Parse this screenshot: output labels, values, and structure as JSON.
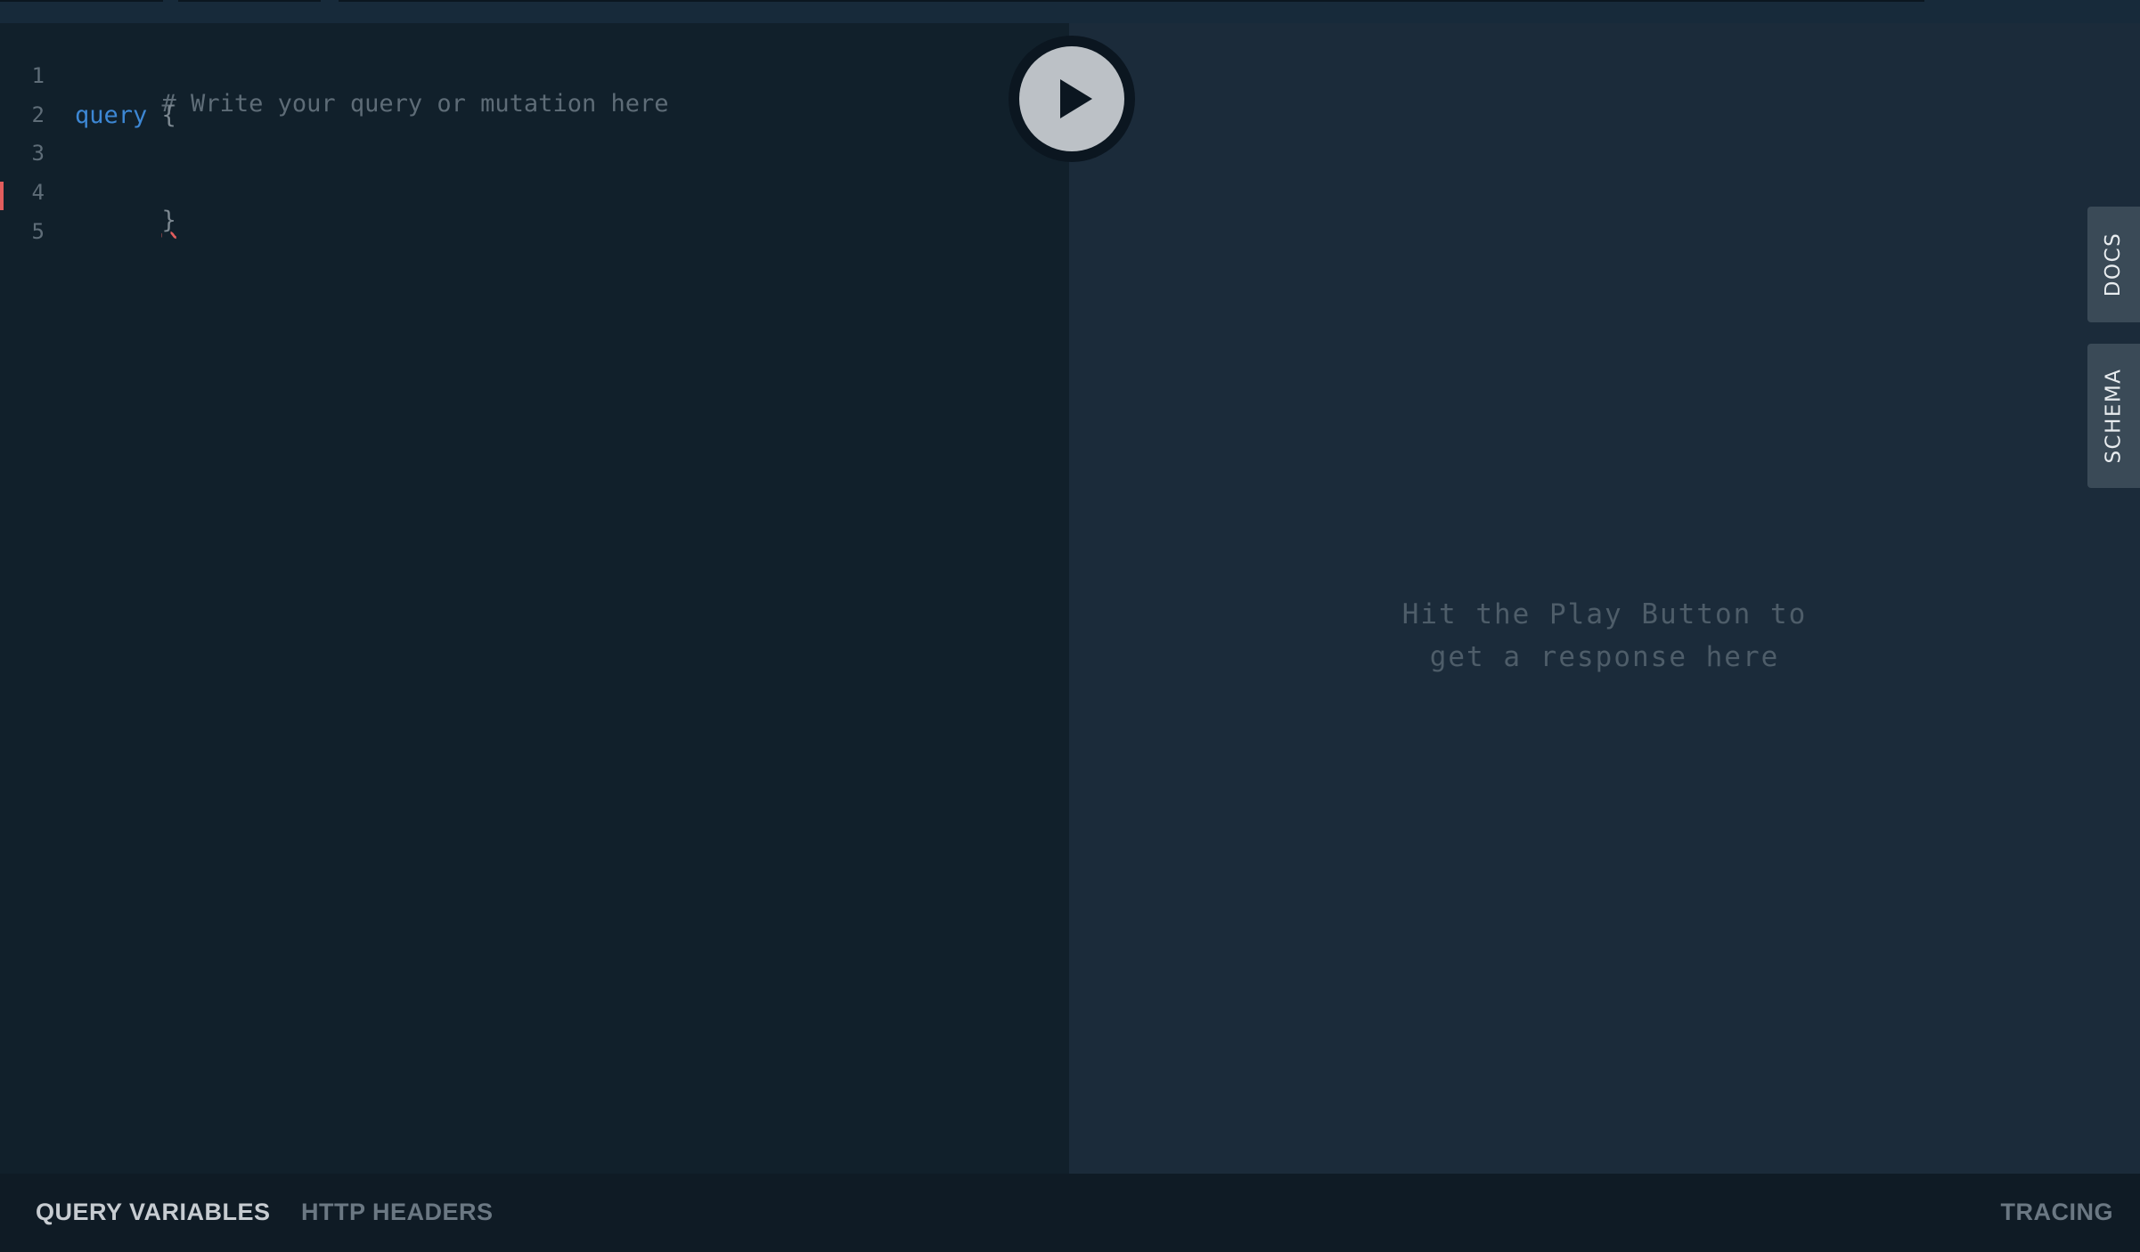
{
  "editor": {
    "line_numbers": [
      "1",
      "2",
      "3",
      "4",
      "5"
    ],
    "lines": {
      "line1_comment": "# Write your query or mutation here",
      "line2_keyword": "query",
      "line2_brace": "{",
      "line4_brace": "}"
    }
  },
  "result": {
    "placeholder_line1": "Hit the Play Button to",
    "placeholder_line2": "get a response here"
  },
  "side_tabs": {
    "docs": "DOCS",
    "schema": "SCHEMA"
  },
  "footer": {
    "query_variables": "QUERY VARIABLES",
    "http_headers": "HTTP HEADERS",
    "tracing": "TRACING"
  },
  "icons": {
    "play": "play-icon"
  },
  "colors": {
    "editor_bg": "#11202b",
    "result_bg": "#1b2b3a",
    "keyword": "#3d87d4",
    "error": "#e25d5d"
  }
}
